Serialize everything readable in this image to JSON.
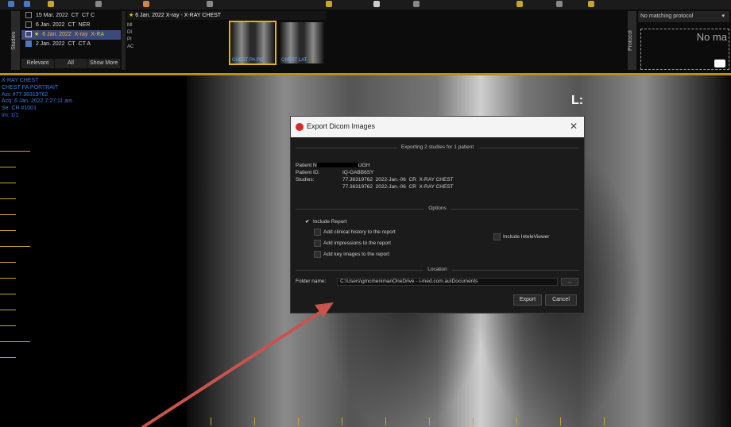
{
  "study_list": {
    "tab_label": "Studies",
    "rows": [
      {
        "date": "15 Mar. 2022",
        "modality": "CT",
        "desc": "CT C"
      },
      {
        "date": "6 Jan. 2022",
        "modality": "CT",
        "desc": "NER"
      },
      {
        "date": "6 Jan. 2022",
        "modality": "X-ray",
        "desc": "X-RA",
        "selected": true
      },
      {
        "date": "2 Jan. 2022",
        "modality": "CT",
        "desc": "CT A"
      }
    ],
    "filter_tabs": [
      "Relevant",
      "All",
      "Show More"
    ]
  },
  "current_study": {
    "header": "6 Jan. 2022  X-ray - X-RAY CHEST",
    "series": [
      {
        "label": "CHEST PA PO",
        "selected": true
      },
      {
        "label": "CHEST LAT",
        "selected": false
      }
    ],
    "side_labels": [
      "MI",
      "DI",
      "PI",
      "AC"
    ]
  },
  "protocol": {
    "tab_label": "Protocol",
    "selected": "No matching protocol",
    "placeholder": "No ma"
  },
  "overlay": {
    "lines": [
      "X-RAY CHEST",
      "CHEST PA PORTRAIT",
      "Acc #77.36319762",
      "Acq: 6 Jan. 2022 7:27:11 am",
      "Se: CR #1001",
      "Im: 1/1"
    ],
    "orientation": "L:"
  },
  "dialog": {
    "title": "Export Dicom Images",
    "close": "✕",
    "summary_section": "Exporting 2 studies for 1 patient",
    "patient_name_label": "Patient N",
    "patient_name_suffix": "UGH",
    "patient_id_label": "Patient ID:",
    "patient_id": "IQ-GABB6SY",
    "studies_label": "Studies:",
    "studies": [
      {
        "acc": "77.36319762",
        "date": "2022-Jan.-06",
        "mod": "CR",
        "desc": "X-RAY CHEST"
      },
      {
        "acc": "77.36319762",
        "date": "2022-Jan.-06",
        "mod": "CR",
        "desc": "X-RAY CHEST"
      }
    ],
    "options_section": "Options",
    "options": {
      "include_report": "Include Report",
      "clinical_history": "Add clinical history to the report",
      "impressions": "Add impressions to the report",
      "key_images": "Add key images to the report",
      "inteleviewer": "Include InteleViewer"
    },
    "location_section": "Location",
    "folder_label": "Folder name:",
    "folder_value": "C:\\Users\\gmcmenimanOneDrive - i-med.com.au\\Documents",
    "browse": "...",
    "export_button": "Export",
    "cancel_button": "Cancel"
  },
  "colors": {
    "accent_gold": "#b8901a",
    "overlay_blue": "#3a7de0",
    "annotation_arrow": "#c9534f"
  }
}
